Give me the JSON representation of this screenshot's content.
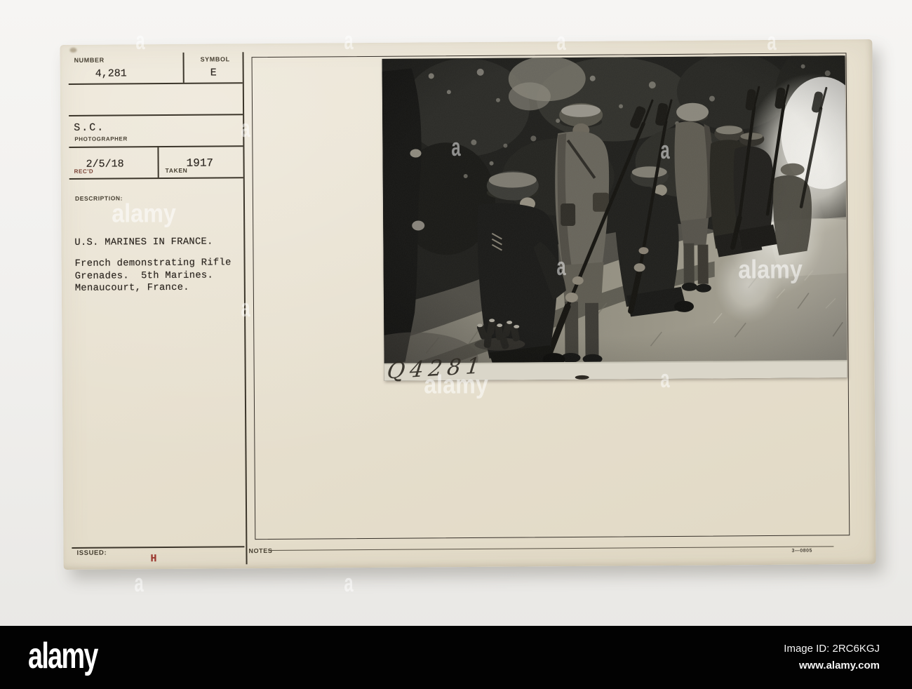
{
  "card": {
    "number_label": "NUMBER",
    "number_value": "4,281",
    "symbol_label": "SYMBOL",
    "symbol_value": "E",
    "photographer_value": "S.C.",
    "photographer_label": "PHOTOGRAPHER",
    "recd_label": "REC'D",
    "recd_value": "2/5/18",
    "taken_label": "TAKEN",
    "taken_value": "1917",
    "description_label": "DESCRIPTION:",
    "description_lines": [
      "U.S. MARINES IN FRANCE.",
      "French demonstrating Rifle",
      "Grenades.  5th Marines.",
      "Menaucourt, France."
    ],
    "issued_label": "ISSUED:",
    "issued_value": "H",
    "notes_label": "NOTES",
    "stock_number": "3—0805",
    "photo": {
      "handwritten_id": "Q4281"
    }
  },
  "watermark": {
    "logo_text": "alamy",
    "letter": "a"
  },
  "footer": {
    "logo": "alamy",
    "image_id": "Image ID: 2RC6KGJ",
    "website": "www.alamy.com"
  },
  "colors": {
    "card_bg": "#e7e0cf",
    "ink_line": "#3c362b",
    "typewriter_ink": "#2e2822",
    "red_ink": "#9c3a31",
    "footer_bg": "#020202",
    "watermark": "#ffffff"
  }
}
